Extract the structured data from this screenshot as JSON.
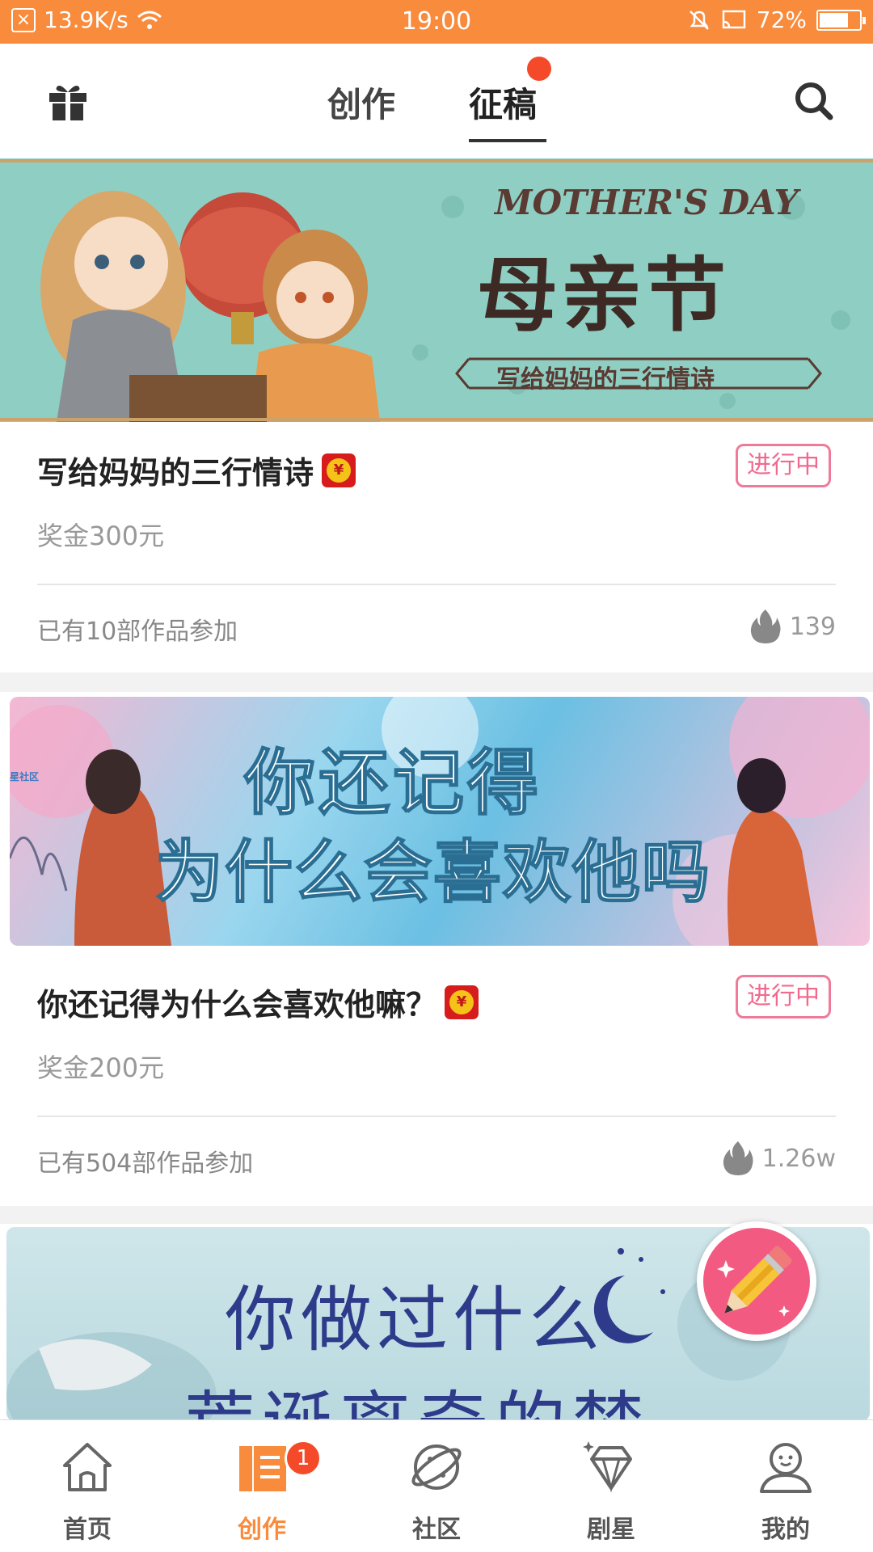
{
  "status_bar": {
    "net_speed": "13.9K/s",
    "time": "19:00",
    "battery": "72%",
    "battery_level": 0.72
  },
  "top_nav": {
    "tabs": [
      {
        "label": "创作"
      },
      {
        "label": "征稿"
      }
    ],
    "active_tab": "征稿",
    "gift_icon": "gift-icon",
    "search_icon": "search-icon"
  },
  "contests": [
    {
      "banner": {
        "en": "MOTHER'S DAY",
        "main": "母亲节",
        "sub": "写给妈妈的三行情诗"
      },
      "title": "写给妈妈的三行情诗",
      "status": "进行中",
      "prize": "奖金300元",
      "participants": "已有10部作品参加",
      "heat": "139"
    },
    {
      "banner": {
        "line1": "你还记得",
        "line2": "为什么会喜欢他吗",
        "watermark": "流星社区"
      },
      "title": "你还记得为什么会喜欢他嘛？",
      "status": "进行中",
      "prize": "奖金200元",
      "participants": "已有504部作品参加",
      "heat": "1.26w"
    },
    {
      "banner": {
        "line1": "你做过什么",
        "line2": "荒诞离奇的梦"
      }
    }
  ],
  "bottom_nav": {
    "items": [
      {
        "label": "首页",
        "icon": "home-icon"
      },
      {
        "label": "创作",
        "icon": "book-icon",
        "badge": "1"
      },
      {
        "label": "社区",
        "icon": "planet-icon"
      },
      {
        "label": "剧星",
        "icon": "diamond-icon"
      },
      {
        "label": "我的",
        "icon": "person-icon"
      }
    ],
    "active": "创作"
  },
  "colors": {
    "accent": "#f98b3c",
    "status_pink": "#f06a8e",
    "badge_red": "#f44a2a"
  }
}
